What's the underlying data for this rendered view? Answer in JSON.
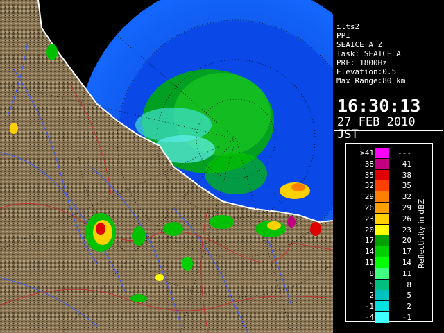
{
  "info": {
    "site": "ilts2",
    "mode": "PPI",
    "product": "SEAICE_A_Z",
    "task": "Task: SEAICE_A",
    "prf": "PRF: 1800Hz",
    "elevation": "Elevation:0.5",
    "max_range": "Max Range:80 km",
    "time": "16:30:13",
    "date": "27 FEB 2010 JST"
  },
  "legend": {
    "unit_label": "Reflectivity in dBZ",
    "rows": [
      {
        "lo": ">41",
        "hi": "---",
        "color": "#ff00ff"
      },
      {
        "lo": "38",
        "hi": "41",
        "color": "#c00080"
      },
      {
        "lo": "35",
        "hi": "38",
        "color": "#e00000"
      },
      {
        "lo": "32",
        "hi": "35",
        "color": "#ff4000"
      },
      {
        "lo": "29",
        "hi": "32",
        "color": "#ff8000"
      },
      {
        "lo": "26",
        "hi": "29",
        "color": "#ffa000"
      },
      {
        "lo": "23",
        "hi": "26",
        "color": "#ffd000"
      },
      {
        "lo": "20",
        "hi": "23",
        "color": "#ffff00"
      },
      {
        "lo": "17",
        "hi": "20",
        "color": "#00a000"
      },
      {
        "lo": "14",
        "hi": "17",
        "color": "#00d000"
      },
      {
        "lo": "11",
        "hi": "14",
        "color": "#00ff00"
      },
      {
        "lo": "8",
        "hi": "11",
        "color": "#40ff80"
      },
      {
        "lo": "5",
        "hi": "8",
        "color": "#00c080"
      },
      {
        "lo": "2",
        "hi": "5",
        "color": "#00c0c0"
      },
      {
        "lo": "-1",
        "hi": "2",
        "color": "#00e0e0"
      },
      {
        "lo": "-4",
        "hi": "-1",
        "color": "#40ffff"
      }
    ]
  },
  "colors": {
    "sea_far": "#1060ff",
    "sea_near": "#0040d0",
    "land": "#8c7a5a",
    "land_dark": "#4a3c28",
    "rivers": "#3050ff",
    "borders": "#c03030",
    "coast": "#ffffff",
    "echo_green": "#00c000",
    "echo_cyan": "#40e0e0"
  }
}
